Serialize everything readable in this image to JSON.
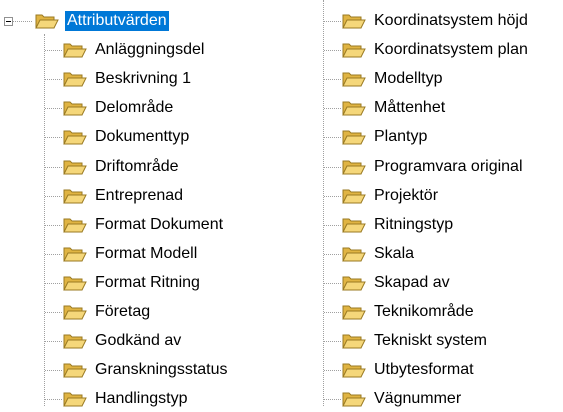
{
  "tree": {
    "root": {
      "label": "Attributvärden",
      "icon": "open-folder-icon",
      "expanded": true,
      "selected": true
    },
    "colors": {
      "selection_background": "#0078d7",
      "selection_text": "#ffffff",
      "folder_front": "#f5d77a",
      "folder_back": "#e0b443",
      "folder_outline": "#9a7a22",
      "tree_lines": "#a0a0a0"
    },
    "children": [
      {
        "label": "Anläggningsdel",
        "icon": "open-folder-icon"
      },
      {
        "label": "Beskrivning 1",
        "icon": "open-folder-icon"
      },
      {
        "label": "Delområde",
        "icon": "open-folder-icon"
      },
      {
        "label": "Dokumenttyp",
        "icon": "open-folder-icon"
      },
      {
        "label": "Driftområde",
        "icon": "open-folder-icon"
      },
      {
        "label": "Entreprenad",
        "icon": "open-folder-icon"
      },
      {
        "label": "Format Dokument",
        "icon": "open-folder-icon"
      },
      {
        "label": "Format Modell",
        "icon": "open-folder-icon"
      },
      {
        "label": "Format Ritning",
        "icon": "open-folder-icon"
      },
      {
        "label": "Företag",
        "icon": "open-folder-icon"
      },
      {
        "label": "Godkänd av",
        "icon": "open-folder-icon"
      },
      {
        "label": "Granskningsstatus",
        "icon": "open-folder-icon"
      },
      {
        "label": "Handlingstyp",
        "icon": "open-folder-icon"
      },
      {
        "label": "Koordinatsystem höjd",
        "icon": "open-folder-icon"
      },
      {
        "label": "Koordinatsystem plan",
        "icon": "open-folder-icon"
      },
      {
        "label": "Modelltyp",
        "icon": "open-folder-icon"
      },
      {
        "label": "Måttenhet",
        "icon": "open-folder-icon"
      },
      {
        "label": "Plantyp",
        "icon": "open-folder-icon"
      },
      {
        "label": "Programvara original",
        "icon": "open-folder-icon"
      },
      {
        "label": "Projektör",
        "icon": "open-folder-icon"
      },
      {
        "label": "Ritningstyp",
        "icon": "open-folder-icon"
      },
      {
        "label": "Skala",
        "icon": "open-folder-icon"
      },
      {
        "label": "Skapad av",
        "icon": "open-folder-icon"
      },
      {
        "label": "Teknikområde",
        "icon": "open-folder-icon"
      },
      {
        "label": "Tekniskt system",
        "icon": "open-folder-icon"
      },
      {
        "label": "Utbytesformat",
        "icon": "open-folder-icon"
      },
      {
        "label": "Vägnummer",
        "icon": "open-folder-icon"
      }
    ]
  }
}
